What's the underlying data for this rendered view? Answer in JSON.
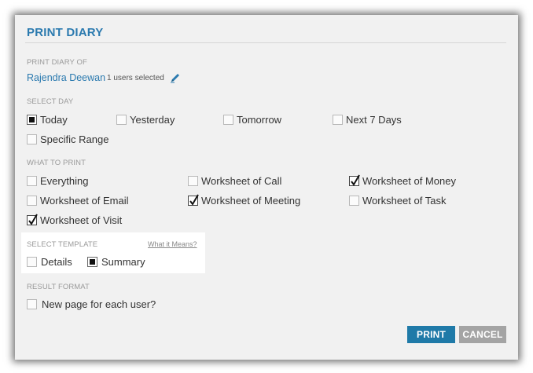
{
  "dialog": {
    "title": "PRINT DIARY",
    "colors": {
      "accent": "#2b7aaf",
      "print_button": "#1f7aa8",
      "cancel_button": "#a4a4a4"
    }
  },
  "print_diary_of": {
    "label": "PRINT DIARY OF",
    "user_name": "Rajendra Deewan",
    "users_selected": "1 users selected",
    "edit_icon": "pencil-icon"
  },
  "select_day": {
    "label": "SELECT DAY",
    "options": [
      {
        "label": "Today",
        "checked": true
      },
      {
        "label": "Yesterday",
        "checked": false
      },
      {
        "label": "Tomorrow",
        "checked": false
      },
      {
        "label": "Next 7 Days",
        "checked": false
      },
      {
        "label": "Specific Range",
        "checked": false
      }
    ]
  },
  "what_to_print": {
    "label": "WHAT TO PRINT",
    "options": [
      {
        "label": "Everything",
        "checked": false
      },
      {
        "label": "Worksheet of Call",
        "checked": false
      },
      {
        "label": "Worksheet of Money",
        "checked": true
      },
      {
        "label": "Worksheet of Email",
        "checked": false
      },
      {
        "label": "Worksheet of Meeting",
        "checked": true
      },
      {
        "label": "Worksheet of Task",
        "checked": false
      },
      {
        "label": "Worksheet of Visit",
        "checked": true
      }
    ]
  },
  "select_template": {
    "label": "SELECT TEMPLATE",
    "help_link": "What it Means?",
    "options": [
      {
        "label": "Details",
        "checked": false
      },
      {
        "label": "Summary",
        "checked": true
      }
    ]
  },
  "result_format": {
    "label": "RESULT FORMAT",
    "options": [
      {
        "label": "New page for each user?",
        "checked": false
      }
    ]
  },
  "buttons": {
    "print": "PRINT",
    "cancel": "CANCEL"
  }
}
